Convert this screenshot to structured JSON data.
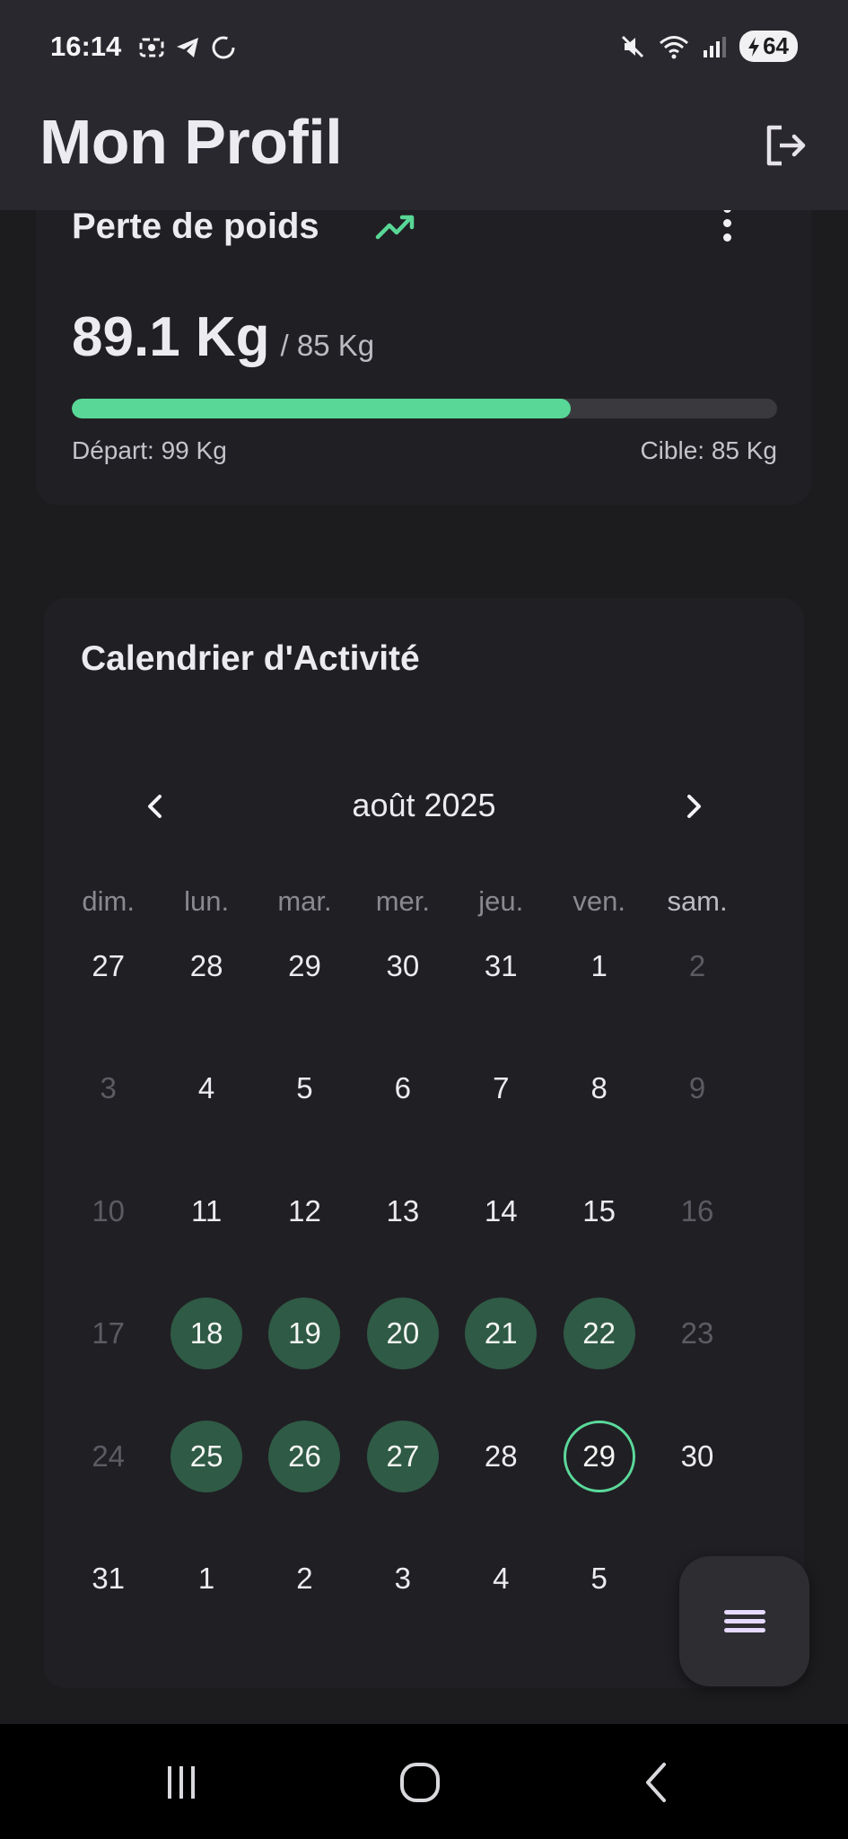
{
  "status_bar": {
    "time": "16:14",
    "battery_level": "64",
    "icons": [
      "screen-record-icon",
      "telegram-icon",
      "sync-icon",
      "mute-icon",
      "wifi-icon",
      "signal-icon",
      "battery-charging-icon"
    ]
  },
  "header": {
    "title": "Mon Profil",
    "action_icon": "logout-icon"
  },
  "weight_goal": {
    "title": "Perte de poids",
    "trend_icon": "trending-up-icon",
    "current": "89.1 Kg",
    "target": "/ 85 Kg",
    "progress_fraction": 0.707,
    "start_label": "Départ: 99 Kg",
    "target_label": "Cible: 85 Kg",
    "accent_color": "#58d796"
  },
  "calendar": {
    "title": "Calendrier d'Activité",
    "month_label": "août 2025",
    "weekdays": [
      "dim.",
      "lun.",
      "mar.",
      "mer.",
      "jeu.",
      "ven.",
      "sam."
    ],
    "weeks": [
      [
        {
          "d": "27",
          "s": "normal"
        },
        {
          "d": "28",
          "s": "normal"
        },
        {
          "d": "29",
          "s": "normal"
        },
        {
          "d": "30",
          "s": "normal"
        },
        {
          "d": "31",
          "s": "normal"
        },
        {
          "d": "1",
          "s": "normal"
        },
        {
          "d": "2",
          "s": "muted"
        }
      ],
      [
        {
          "d": "3",
          "s": "muted"
        },
        {
          "d": "4",
          "s": "normal"
        },
        {
          "d": "5",
          "s": "normal"
        },
        {
          "d": "6",
          "s": "normal"
        },
        {
          "d": "7",
          "s": "normal"
        },
        {
          "d": "8",
          "s": "normal"
        },
        {
          "d": "9",
          "s": "muted"
        }
      ],
      [
        {
          "d": "10",
          "s": "muted"
        },
        {
          "d": "11",
          "s": "normal"
        },
        {
          "d": "12",
          "s": "normal"
        },
        {
          "d": "13",
          "s": "normal"
        },
        {
          "d": "14",
          "s": "normal"
        },
        {
          "d": "15",
          "s": "normal"
        },
        {
          "d": "16",
          "s": "muted"
        }
      ],
      [
        {
          "d": "17",
          "s": "muted"
        },
        {
          "d": "18",
          "s": "done"
        },
        {
          "d": "19",
          "s": "done"
        },
        {
          "d": "20",
          "s": "done"
        },
        {
          "d": "21",
          "s": "done"
        },
        {
          "d": "22",
          "s": "done"
        },
        {
          "d": "23",
          "s": "muted"
        }
      ],
      [
        {
          "d": "24",
          "s": "muted"
        },
        {
          "d": "25",
          "s": "done"
        },
        {
          "d": "26",
          "s": "done"
        },
        {
          "d": "27",
          "s": "done"
        },
        {
          "d": "28",
          "s": "normal"
        },
        {
          "d": "29",
          "s": "today"
        },
        {
          "d": "30",
          "s": "normal"
        }
      ],
      [
        {
          "d": "31",
          "s": "normal"
        },
        {
          "d": "1",
          "s": "normal"
        },
        {
          "d": "2",
          "s": "normal"
        },
        {
          "d": "3",
          "s": "normal"
        },
        {
          "d": "4",
          "s": "normal"
        },
        {
          "d": "5",
          "s": "normal"
        },
        {
          "d": "",
          "s": "normal"
        }
      ]
    ],
    "done_color": "#2f5a45",
    "today_ring_color": "#5bd99a"
  },
  "fab": {
    "icon": "menu-icon"
  },
  "system_nav": {
    "icons": [
      "recent-apps-icon",
      "home-icon",
      "back-icon"
    ]
  }
}
